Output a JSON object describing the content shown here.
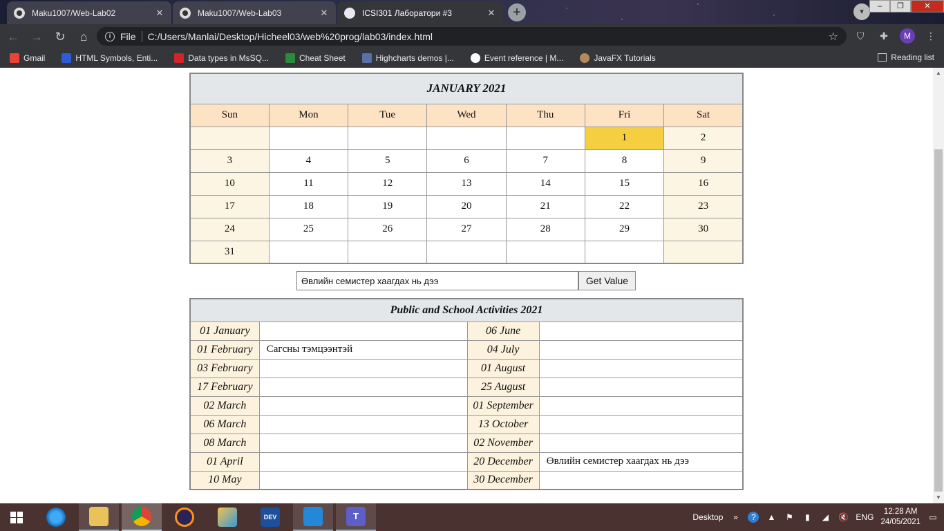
{
  "browser": {
    "tabs": [
      {
        "title": "Maku1007/Web-Lab02",
        "close": "✕"
      },
      {
        "title": "Maku1007/Web-Lab03",
        "close": "✕"
      },
      {
        "title": "ICSI301 Лаборатори #3",
        "close": "✕"
      }
    ],
    "new_tab": "+",
    "address": {
      "label": "File",
      "url": "C:/Users/Manlai/Desktop/Hicheel03/web%20prog/lab03/index.html"
    },
    "bookmarks": [
      {
        "label": "Gmail",
        "color": "#ea4335"
      },
      {
        "label": "HTML Symbols, Enti...",
        "color": "#2f5bd6"
      },
      {
        "label": "Data types in MsSQ...",
        "color": "#d2232a"
      },
      {
        "label": "Cheat Sheet",
        "color": "#2c8a3a"
      },
      {
        "label": "Highcharts demos |...",
        "color": "#5b6fa8"
      },
      {
        "label": "Event reference | M...",
        "color": "#ffffff"
      },
      {
        "label": "JavaFX Tutorials",
        "color": "#b48a5a"
      }
    ],
    "reading_list": "Reading list",
    "profile_initial": "M"
  },
  "calendar": {
    "title": "JANUARY 2021",
    "days_of_week": [
      "Sun",
      "Mon",
      "Tue",
      "Wed",
      "Thu",
      "Fri",
      "Sat"
    ],
    "weeks": [
      [
        "",
        "",
        "",
        "",
        "",
        "1",
        "2"
      ],
      [
        "3",
        "4",
        "5",
        "6",
        "7",
        "8",
        "9"
      ],
      [
        "10",
        "11",
        "12",
        "13",
        "14",
        "15",
        "16"
      ],
      [
        "17",
        "18",
        "19",
        "20",
        "21",
        "22",
        "23"
      ],
      [
        "24",
        "25",
        "26",
        "27",
        "28",
        "29",
        "30"
      ],
      [
        "31",
        "",
        "",
        "",
        "",
        "",
        ""
      ]
    ],
    "highlighted_day": "1"
  },
  "form": {
    "input_value": "Өвлийн семистер хаагдах нь дээ",
    "button_label": "Get Value"
  },
  "activities": {
    "title": "Public and School Activities 2021",
    "rows": [
      {
        "date1": "01 January",
        "event1": "",
        "date2": "06 June",
        "event2": ""
      },
      {
        "date1": "01 February",
        "event1": "Сагсны тэмцээнтэй",
        "date2": "04 July",
        "event2": ""
      },
      {
        "date1": "03 February",
        "event1": "",
        "date2": "01 August",
        "event2": ""
      },
      {
        "date1": "17 February",
        "event1": "",
        "date2": "25 August",
        "event2": ""
      },
      {
        "date1": "02 March",
        "event1": "",
        "date2": "01 September",
        "event2": ""
      },
      {
        "date1": "06 March",
        "event1": "",
        "date2": "13 October",
        "event2": ""
      },
      {
        "date1": "08 March",
        "event1": "",
        "date2": "02 November",
        "event2": ""
      },
      {
        "date1": "01 April",
        "event1": "",
        "date2": "20 December",
        "event2": "Өвлийн семистер хаагдах нь дээ"
      },
      {
        "date1": "10 May",
        "event1": "",
        "date2": "30 December",
        "event2": ""
      }
    ]
  },
  "taskbar": {
    "desktop_label": "Desktop",
    "language": "ENG",
    "time": "12:28 AM",
    "date": "24/05/2021"
  }
}
